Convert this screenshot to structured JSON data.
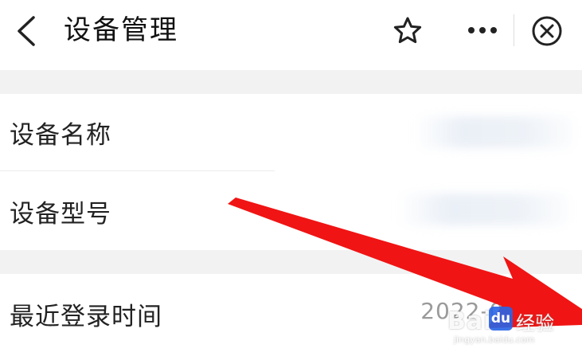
{
  "header": {
    "title": "设备管理",
    "back_icon": "chevron-left-icon",
    "favorite_icon": "star-icon",
    "more_icon": "more-horizontal-icon",
    "close_icon": "close-circle-icon"
  },
  "device_info": {
    "rows": [
      {
        "label": "设备名称"
      },
      {
        "label": "设备型号"
      }
    ]
  },
  "login_info": {
    "label": "最近登录时间",
    "value": "2022-07-… 4"
  },
  "annotation": {
    "arrow_color": "#f01414"
  },
  "watermark": {
    "brand": "Bai",
    "du": "du",
    "jingyan": "经验",
    "url": "jingyan.baidu.com"
  },
  "colors": {
    "background": "#f2f2f2",
    "card": "#ffffff",
    "text_primary": "#222222",
    "text_secondary": "#9a9a9a"
  }
}
